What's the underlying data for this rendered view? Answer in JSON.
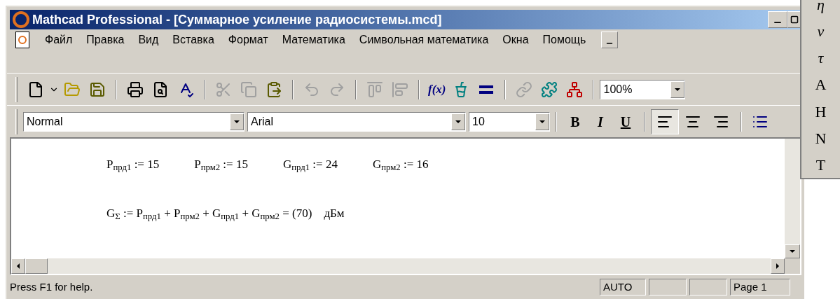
{
  "window": {
    "title": "Mathcad Professional - [Суммарное усиление радиосистемы.mcd]"
  },
  "menu": [
    "Файл",
    "Правка",
    "Вид",
    "Вставка",
    "Формат",
    "Математика",
    "Символьная математика",
    "Окна",
    "Помощь"
  ],
  "standard_toolbar": [
    {
      "disabled": false
    },
    {
      "disabled": false
    },
    {
      "disabled": false
    },
    {
      "disabled": false
    },
    {
      "disabled": false
    },
    {
      "disabled": false
    },
    {
      "disabled": false
    },
    {
      "disabled": true
    },
    {
      "disabled": true
    },
    {
      "disabled": false
    },
    {
      "disabled": true
    },
    {
      "disabled": true
    },
    {
      "disabled": true
    },
    {
      "disabled": true
    },
    {
      "label": "f(x)",
      "disabled": false
    },
    {
      "disabled": false
    },
    {
      "disabled": false
    },
    {
      "disabled": true
    },
    {
      "disabled": false
    },
    {
      "disabled": false
    }
  ],
  "zoom": {
    "value": "100%"
  },
  "format_toolbar": {
    "style": "Normal",
    "font": "Arial",
    "size": "10",
    "styles": [
      {
        "label": "B",
        "kind": "bold"
      },
      {
        "label": "I",
        "kind": "italic"
      },
      {
        "label": "U",
        "kind": "underline"
      }
    ],
    "alignment": [
      {
        "kind": "left",
        "selected": true
      },
      {
        "kind": "center",
        "selected": false
      },
      {
        "kind": "right",
        "selected": false
      }
    ]
  },
  "worksheet": {
    "rows": [
      [
        "P$_{прд1}$ := 15",
        "P$_{прм2}$ := 15",
        "G$_{прд1}$ := 24",
        "G$_{прм2}$ := 16"
      ],
      [
        "G$_{Σ}$ := P$_{прд1}$ + P$_{прм2}$ + G$_{прд1}$ + G$_{прм2}$ = (70)    дБм"
      ]
    ]
  },
  "status_bar": {
    "help": "Press F1 for help.",
    "mode": "AUTO",
    "page": "Page 1"
  },
  "greek_palette": [
    "η",
    "ν",
    "τ",
    "Α",
    "Η",
    "Ν",
    "Τ"
  ]
}
